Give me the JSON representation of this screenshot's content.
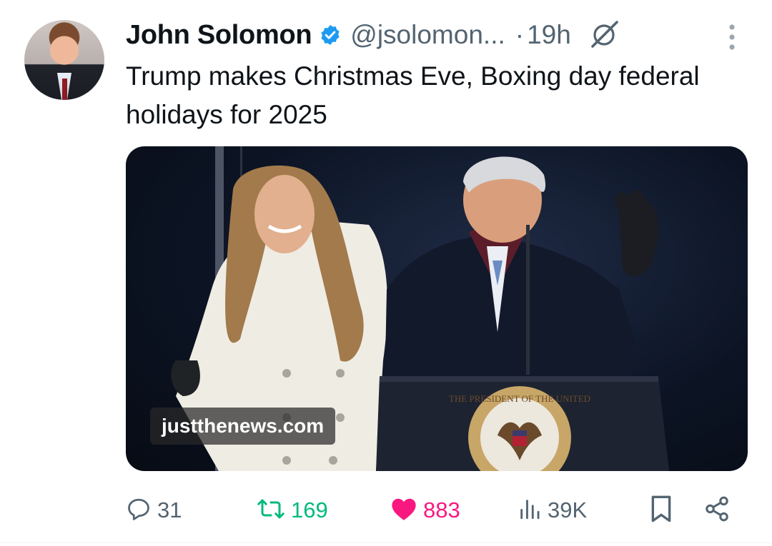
{
  "author": {
    "name": "John Solomon",
    "handle": "@jsolomon...",
    "separator": "·",
    "time": "19h"
  },
  "tweet": {
    "text": "Trump makes Christmas Eve, Boxing day federal holidays for 2025"
  },
  "media": {
    "watermark": "justthenews.com",
    "seal_text": "THE PRESIDENT OF THE UNITED"
  },
  "actions": {
    "replies": "31",
    "reposts": "169",
    "likes": "883",
    "views": "39K"
  },
  "colors": {
    "verified": "#1d9bf0",
    "repost": "#00ba7c",
    "like": "#f91880",
    "muted": "#536471"
  },
  "icons": [
    "verified-badge-icon",
    "grok-icon",
    "more-icon",
    "reply-icon",
    "repost-icon",
    "like-icon",
    "views-icon",
    "bookmark-icon",
    "share-icon"
  ]
}
